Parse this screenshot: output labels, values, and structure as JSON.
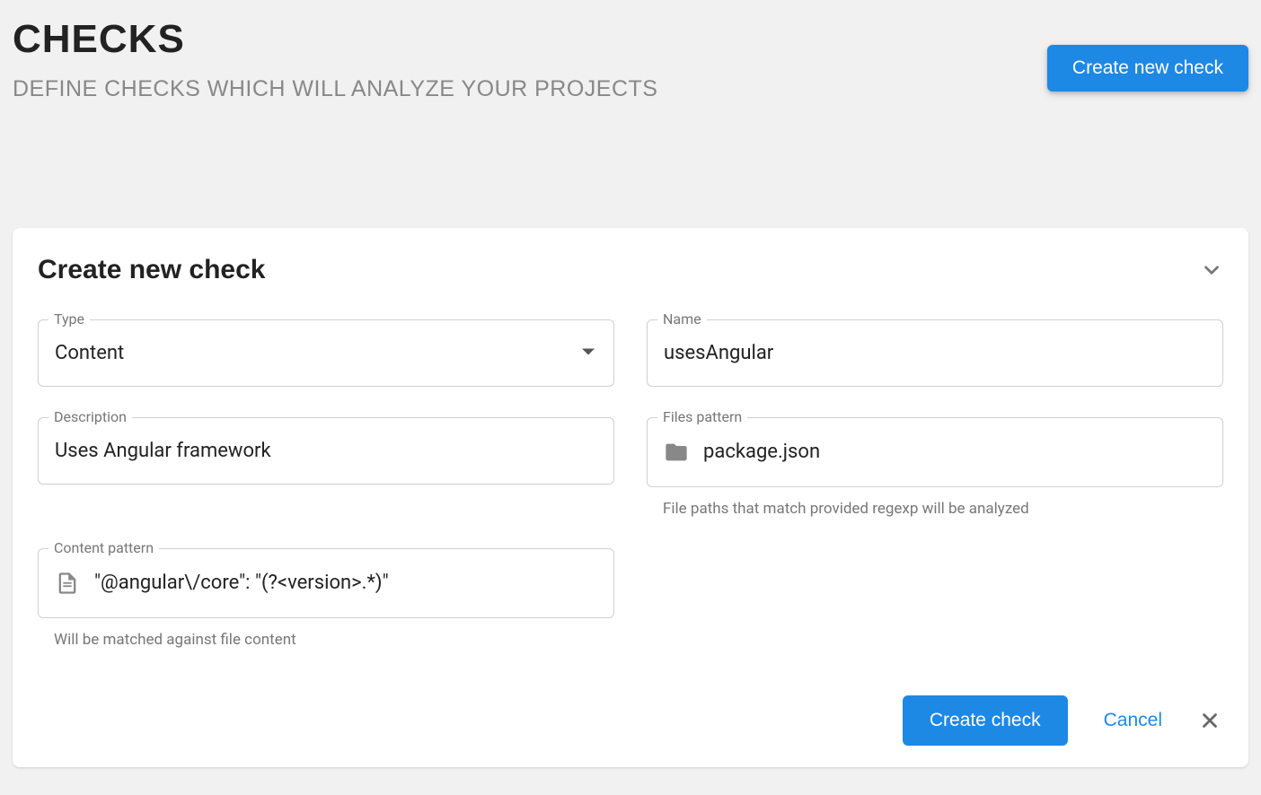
{
  "header": {
    "title": "CHECKS",
    "subtitle": "DEFINE CHECKS WHICH WILL ANALYZE YOUR PROJECTS",
    "create_button": "Create new check"
  },
  "card": {
    "title": "Create new check"
  },
  "form": {
    "type": {
      "label": "Type",
      "value": "Content"
    },
    "name": {
      "label": "Name",
      "value": "usesAngular"
    },
    "description": {
      "label": "Description",
      "value": "Uses Angular framework"
    },
    "files_pattern": {
      "label": "Files pattern",
      "value": "package.json",
      "hint": "File paths that match provided regexp will be analyzed"
    },
    "content_pattern": {
      "label": "Content pattern",
      "value": "\"@angular\\/core\": \"(?<version>.*)\"",
      "hint": "Will be matched against file content"
    }
  },
  "actions": {
    "create": "Create check",
    "cancel": "Cancel"
  }
}
